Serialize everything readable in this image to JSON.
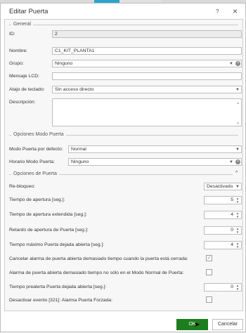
{
  "window": {
    "title": "Editar Puerta",
    "help_icon": "?",
    "close_icon": "×"
  },
  "general": {
    "section_label": "General",
    "id_label": "ID:",
    "id_value": "2",
    "nombre_label": "Nombre:",
    "nombre_value": "C1_KIT_PLANTA1",
    "grupo_label": "Grupo:",
    "grupo_value": "Ninguno",
    "mensaje_label": "Mensaje LCD:",
    "mensaje_value": "",
    "atajo_label": "Atajo de teclado:",
    "atajo_value": "Sin acceso directo",
    "descripcion_label": "Descripción:",
    "descripcion_value": ""
  },
  "modo": {
    "section_label": "Opciones Modo Puerta",
    "defecto_label": "Modo Puerta por defecto:",
    "defecto_value": "Normal",
    "horario_label": "Horario Modo Puerta:",
    "horario_value": "Ninguno"
  },
  "opciones": {
    "section_label": "Opciones de Puerta",
    "rebloqueo_label": "Re-bloqueo:",
    "rebloqueo_value": "Desactivado",
    "apertura_label": "Tiempo de apertura [seg.]:",
    "apertura_value": "5",
    "extendida_label": "Tiempo de apertura extendida [seg.]:",
    "extendida_value": "4",
    "retardo_label": "Retardo de apertura de Puerta [seg.]:",
    "retardo_value": "0",
    "maximo_label": "Tiempo máximo Puerta dejada abierta [seg.]:",
    "maximo_value": "4",
    "cancelar_label": "Cancelar alarma de puerta abierta demasiado tiempo cuando la puerta está cerrada:",
    "cancelar_checked": true,
    "alarma_label": "Alarma de puerta abierta demasiado tiempo no sólo en el Modo Normal de Puerta:",
    "alarma_checked": false,
    "prealerta_label": "Tiempo prealerta Puerta dejada abierta [seg.]:",
    "prealerta_value": "0",
    "desactivar_label": "Desactivar evento [321]: Alarma Puerta Forzada:",
    "desactivar_checked": false
  },
  "footer": {
    "ok_label": "OK",
    "cancel_label": "Cancelar"
  },
  "colors": {
    "ok_green": "#1e7d1e",
    "accent": "#2aa5c9"
  }
}
